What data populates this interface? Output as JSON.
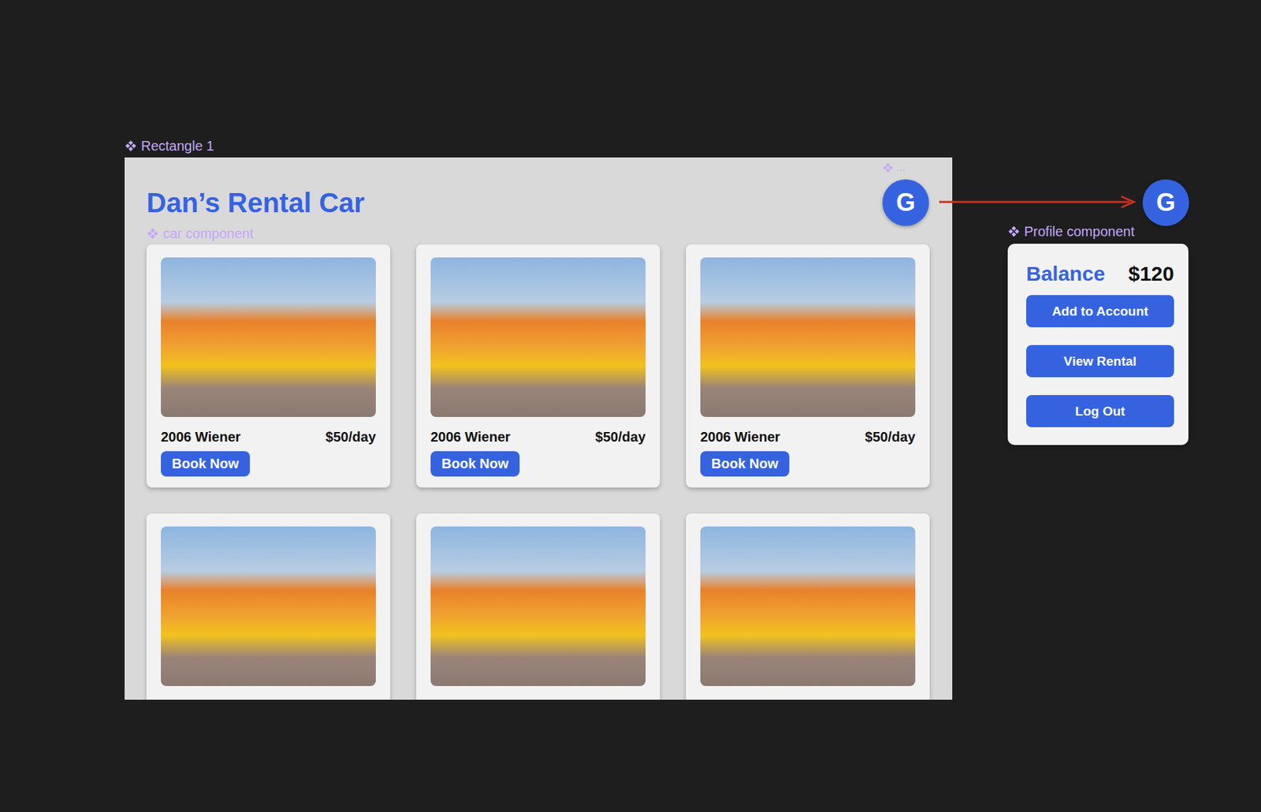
{
  "canvas_labels": {
    "frame": "Rectangle 1",
    "cards": "car component",
    "avatar": "...",
    "profile": "Profile component"
  },
  "app": {
    "title": "Dan’s Rental Car",
    "avatar": "G"
  },
  "cars": [
    {
      "kind": "full",
      "name": "2006 Wiener",
      "price": "$50/day",
      "button": "Book Now"
    },
    {
      "kind": "full",
      "name": "2006 Wiener",
      "price": "$50/day",
      "button": "Book Now"
    },
    {
      "kind": "full",
      "name": "2006 Wiener",
      "price": "$50/day",
      "button": "Book Now"
    },
    {
      "kind": "clipped"
    },
    {
      "kind": "clipped"
    },
    {
      "kind": "clipped"
    }
  ],
  "profile": {
    "avatar": "G",
    "balance_label": "Balance",
    "balance": "$120",
    "buttons": [
      "Add to Account",
      "View Rental",
      "Log Out"
    ]
  }
}
